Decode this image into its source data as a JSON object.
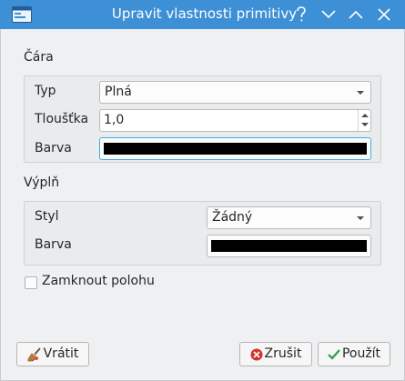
{
  "window": {
    "title": "Upravit vlastnosti primitivy"
  },
  "line_section": {
    "heading": "Čára",
    "type_label": "Typ",
    "type_value": "Plná",
    "width_label": "Tloušťka",
    "width_value": "1,0",
    "color_label": "Barva",
    "color_value": "#000000"
  },
  "fill_section": {
    "heading": "Výplň",
    "style_label": "Styl",
    "style_value": "Žádný",
    "color_label": "Barva",
    "color_value": "#000000"
  },
  "lock": {
    "label": "Zamknout polohu",
    "checked": false
  },
  "buttons": {
    "revert": "Vrátit",
    "cancel": "Zrušit",
    "apply": "Použít"
  },
  "colors": {
    "titlebar": "#3d8fd6",
    "focus": "#3daee9"
  }
}
